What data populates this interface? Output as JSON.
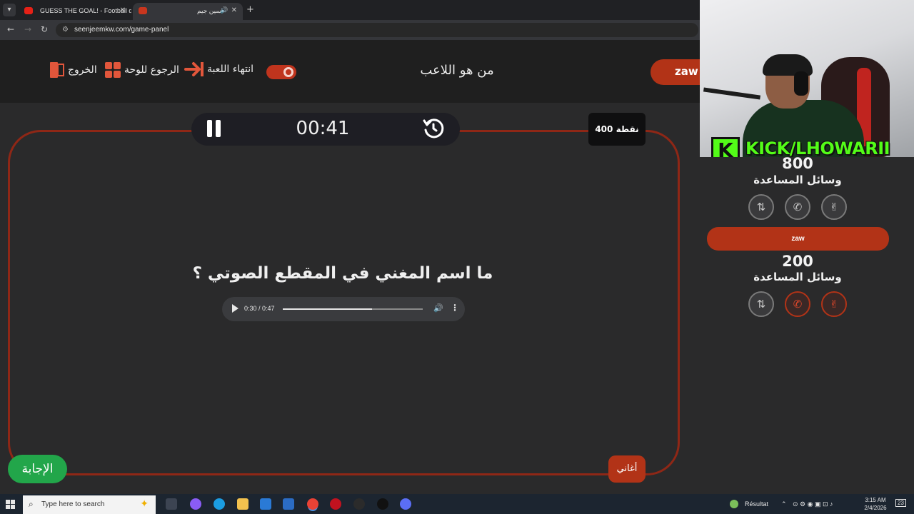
{
  "browser": {
    "tabs": [
      {
        "title": "GUESS THE GOAL! - Football q",
        "active": false
      },
      {
        "title": "سين جيم",
        "active": true
      }
    ],
    "url": "seenjeemkw.com/game-panel"
  },
  "header": {
    "title": "من هو اللاعب",
    "end_game": "انتهاء اللعبة",
    "back_to_board": "الرجوع للوحة",
    "exit": "الخروج",
    "current_team": "zaw"
  },
  "game": {
    "timer": "00:41",
    "points": "400 نقطة",
    "question": "ما اسم المغني في المقطع الصوتي ؟",
    "audio": {
      "time": "0:30 / 0:47",
      "progress": 0.64
    },
    "category": "أغاني",
    "answer_button": "الإجابة"
  },
  "overlay": {
    "kick_text": "KICK/LHOWARII"
  },
  "players": [
    {
      "name": "",
      "score": "800",
      "helpers_label": "وسائل المساعدة",
      "lifelines_used": [
        false,
        false,
        false
      ]
    },
    {
      "name": "zaw",
      "score": "200",
      "helpers_label": "وسائل المساعدة",
      "lifelines_used": [
        true,
        true,
        false
      ]
    }
  ],
  "taskbar": {
    "search_placeholder": "Type here to search",
    "weather": "Résultat",
    "time": "3:15 AM",
    "date": "2/4/2026",
    "notifications": "23"
  },
  "colors": {
    "accent": "#b23317",
    "answer": "#22a64a",
    "kick": "#53fc18"
  }
}
